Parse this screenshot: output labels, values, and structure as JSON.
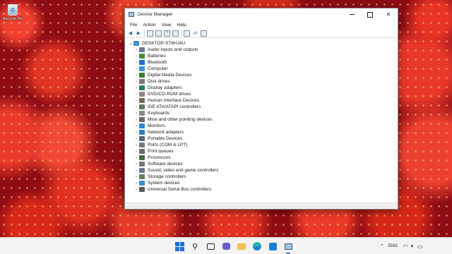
{
  "desktop": {
    "recycle_bin_label": "Recycle Bin",
    "wallpaper": "strawberries"
  },
  "window": {
    "title": "Device Manager",
    "menu": [
      "File",
      "Action",
      "View",
      "Help"
    ],
    "tree": {
      "root": "DESKTOP-ST8HJ4U",
      "items": [
        {
          "label": "Audio inputs and outputs",
          "icon": "speaker-icon",
          "color": "#6b7b8c"
        },
        {
          "label": "Batteries",
          "icon": "battery-icon",
          "color": "#4a8a3c"
        },
        {
          "label": "Bluetooth",
          "icon": "bluetooth-icon",
          "color": "#1f6fd1"
        },
        {
          "label": "Computer",
          "icon": "computer-icon",
          "color": "#3d8fd6"
        },
        {
          "label": "Digital Media Devices",
          "icon": "media-device-icon",
          "color": "#3a7a3a"
        },
        {
          "label": "Disk drives",
          "icon": "disk-drive-icon",
          "color": "#7a7a7a"
        },
        {
          "label": "Display adapters",
          "icon": "display-adapter-icon",
          "color": "#2e7d5a"
        },
        {
          "label": "DVD/CD-ROM drives",
          "icon": "dvd-drive-icon",
          "color": "#8a8a8a"
        },
        {
          "label": "Human Interface Devices",
          "icon": "hid-icon",
          "color": "#7a6a55"
        },
        {
          "label": "IDE ATA/ATAPI controllers",
          "icon": "ide-controller-icon",
          "color": "#5a7a5a"
        },
        {
          "label": "Keyboards",
          "icon": "keyboard-icon",
          "color": "#8a8a8a"
        },
        {
          "label": "Mice and other pointing devices",
          "icon": "mouse-icon",
          "color": "#6a6a6a"
        },
        {
          "label": "Monitors",
          "icon": "monitor-icon",
          "color": "#2f86d8"
        },
        {
          "label": "Network adapters",
          "icon": "network-adapter-icon",
          "color": "#2a7fbf"
        },
        {
          "label": "Portable Devices",
          "icon": "portable-device-icon",
          "color": "#5a6a7a"
        },
        {
          "label": "Ports (COM & LPT)",
          "icon": "port-icon",
          "color": "#7a7a7a"
        },
        {
          "label": "Print queues",
          "icon": "printer-icon",
          "color": "#6a6a6a"
        },
        {
          "label": "Processors",
          "icon": "processor-icon",
          "color": "#4a6a4a"
        },
        {
          "label": "Software devices",
          "icon": "software-device-icon",
          "color": "#7a7a7a"
        },
        {
          "label": "Sound, video and game controllers",
          "icon": "sound-controller-icon",
          "color": "#6b7b8c"
        },
        {
          "label": "Storage controllers",
          "icon": "storage-controller-icon",
          "color": "#6a7a6a"
        },
        {
          "label": "System devices",
          "icon": "system-device-icon",
          "color": "#3d8fd6"
        },
        {
          "label": "Universal Serial Bus controllers",
          "icon": "usb-icon",
          "color": "#5a5a5a"
        }
      ]
    }
  },
  "taskbar": {
    "language": "ENG"
  }
}
